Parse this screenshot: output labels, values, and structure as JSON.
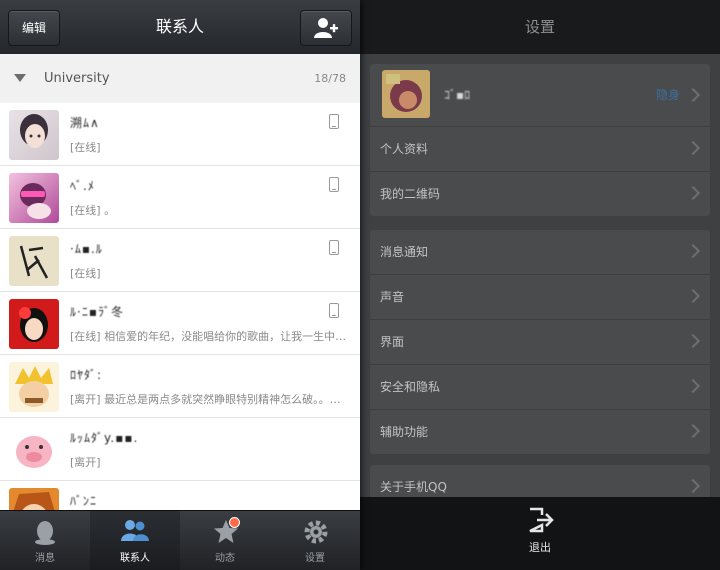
{
  "contacts_panel": {
    "title": "联系人",
    "edit_label": "编辑",
    "group": {
      "name": "University",
      "count": "18/78"
    },
    "contacts": [
      {
        "name": "溯ﾑ∧",
        "status": "[在线]"
      },
      {
        "name": "ﾍﾞ.ﾒ",
        "status": "[在线] 。"
      },
      {
        "name": "·ﾑ▪.ﾙ",
        "status": "[在线]"
      },
      {
        "name": "ﾙ·ﾆ▪ﾗﾞ冬",
        "status": "[在线] 相信爱的年纪，没能唱给你的歌曲，让我一生中常常追..."
      },
      {
        "name": "ﾛﾔﾀﾞ:",
        "status": "[离开] 最近总是两点多就突然睁眼特别精神怎么破。。还没更..."
      },
      {
        "name": "ﾙｯﾑﾀﾞy.▪▪.",
        "status": "[离开]"
      },
      {
        "name": "ﾊﾞﾝﾆ",
        "status": ""
      }
    ]
  },
  "tabbar": {
    "tabs": [
      {
        "label": "消息",
        "icon": "penguin-icon"
      },
      {
        "label": "联系人",
        "icon": "contacts-icon"
      },
      {
        "label": "动态",
        "icon": "star-icon"
      },
      {
        "label": "设置",
        "icon": "gear-icon"
      }
    ]
  },
  "settings_panel": {
    "title": "设置",
    "profile": {
      "name": "ｺﾞ▪ﾛ",
      "status": "隐身"
    },
    "group1": [
      "个人资料",
      "我的二维码"
    ],
    "group2": [
      "消息通知",
      "声音",
      "界面",
      "安全和隐私",
      "辅助功能"
    ],
    "group3": [
      "关于手机QQ"
    ],
    "logout_label": "退出"
  },
  "colors": {
    "active_tab_icon": "#6aa9e6",
    "badge": "#ff6b4a",
    "hidden_status": "#3c6fa0"
  }
}
